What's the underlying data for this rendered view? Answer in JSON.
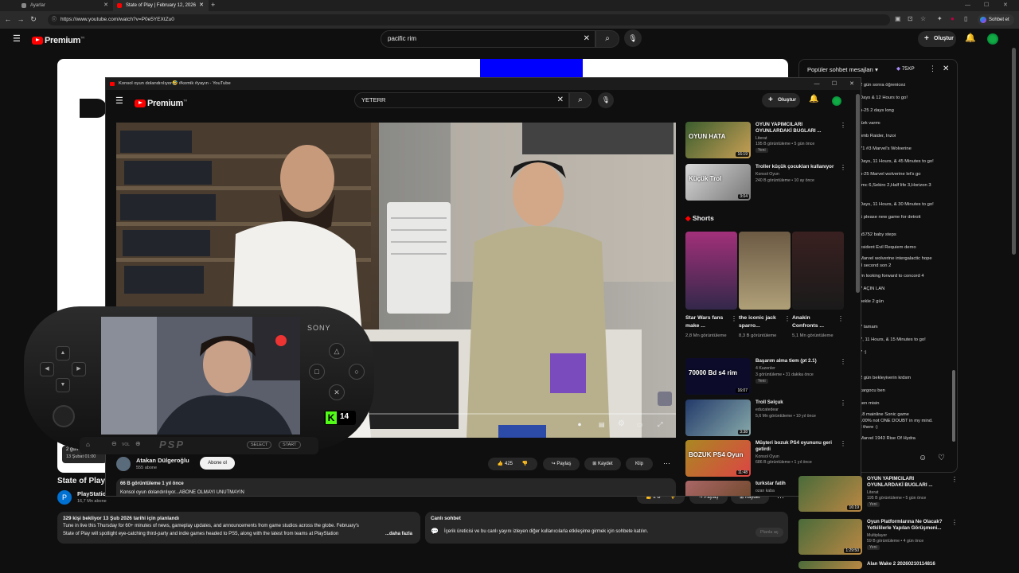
{
  "browser": {
    "tabs": [
      {
        "label": "Ayarlar",
        "active": false
      },
      {
        "label": "State of Play | February 12, 2026",
        "active": true
      }
    ],
    "url": "https://www.youtube.com/watch?v=P0e5YEXtZu0",
    "profile_button": "Sohbet et"
  },
  "main": {
    "logo": "Premium",
    "logo_sup": "TR",
    "search_value": "pacific rim",
    "create_label": "Oluştur",
    "video_title": "State of Play",
    "channel_name": "PlayStation",
    "channel_subs": "16,7 Mn abone",
    "date_overlay": "13 Şubat 01:00",
    "date_overlay_prefix": "2 gün",
    "like_count": "2 B",
    "share_label": "Paylaş",
    "save_label": "Kaydet",
    "desc_header": "329 kişi bekliyor  13 Şub 2026 tarihi için planlandı",
    "desc_line1": "Tune in live this Thursday for 60+ minutes of news, gameplay updates, and announcements from game studios across the globe. February's",
    "desc_line2": "State of Play will spotlight eye-catching third-party and indie games headed to PS5, along with the latest from teams at PlayStation",
    "desc_more": "...daha fazla",
    "live_chat_title": "Canlı sohbet",
    "live_chat_text": "İçerik üreticisi ve bu canlı yayını izleyen diğer kullanıcılarla etkileşime girmek için sohbete katılın.",
    "live_chat_btn": "Planla aç",
    "chat_header": "Popüler sohbet mesajları",
    "chat_points": "75XP",
    "chat_messages": [
      "2 gün sonra öğrenicez",
      "Days & 12 Hours to go!",
      "n-25  2 days long",
      "türk varmı",
      "omb Raider, Inzoi",
      "71  #3  Marvel's Wolverine",
      "Days, 11 Hours, & 45 Minutes to go!",
      "n-25  Marvel wolverine let's go",
      "rmc 6,Sekiro 2,Half life 3,Horizon 3",
      "Days, 11 Hours, & 30 Minutes to go!",
      "5  please new game for detroit",
      "a5752  baby steps",
      "esident Evil Requiem demo",
      "Marvel wolverine intergalactic hope",
      "8 second son 2",
      "im looking forward to concord 4",
      "7  AÇIN LAN",
      "bekle 2 gün",
      "7  tamam",
      "7, 11 Hours, & 15 Minutes to go!",
      "7  :)",
      "2 gün bekleyiverin krdsm",
      "kargocu ben",
      "sen misin",
      "18  mainline Sonic game",
      "100% not ONE DOUBT in my mind.",
      "ll there :)",
      "Marvel 1943 Rise Of Hydra"
    ],
    "right_list": [
      {
        "title": "OYUN YAPIMCILARI OYUNLARDAKİ BUGLARI ...",
        "channel": "Literat",
        "meta": "195 B görüntüleme • 5 gün önce",
        "tag": "Yeni",
        "dur": "16:19"
      },
      {
        "title": "Oyun Platformlarına Ne Olacak? Yetkililerle Yapılan Görüşmeni...",
        "channel": "Multiplayer",
        "meta": "59 B görüntüleme • 4 gün önce",
        "tag": "Yeni",
        "dur": "1:29:50"
      },
      {
        "title": "Alan Wake 2  20260210114816",
        "channel": "",
        "meta": "",
        "tag": "",
        "dur": ""
      }
    ]
  },
  "popup": {
    "window_title": "Konsol oyun dolandırılıyor🤣 #komik #yayın - YouTube",
    "search_value": "YETERR",
    "create_label": "Oluştur",
    "channel_name": "Atakan Dülgeroğlu",
    "channel_subs": "555 abone",
    "subscribe_label": "Abone ol",
    "like_count": "425",
    "share_label": "Paylaş",
    "save_label": "Kaydet",
    "clip_label": "Klip",
    "views": "66 B görüntüleme  1 yıl önce",
    "desc_partial": "Konsol oyun dolandırılıyor...ABONE OLMAYI UNUTMAYIN",
    "kick_count": "14",
    "shorts_label": "Shorts",
    "sidebar_top": [
      {
        "title": "OYUN YAPIMCILARI OYUNLARDAKİ BUGLARI ...",
        "channel": "Literat",
        "meta": "195 B görüntüleme • 5 gün önce",
        "tag": "Yeni",
        "dur": "16:19",
        "thumb_text": "OYUN HATA"
      },
      {
        "title": "Troller küçük çocukları kullanıyor",
        "channel": "Konsol Oyun",
        "meta": "240 B görüntüleme • 10 ay önce",
        "tag": "",
        "dur": "3:04",
        "thumb_text": "Küçük Trol"
      }
    ],
    "shorts": [
      {
        "title": "Star Wars fans make ...",
        "views": "2,8 Mn görüntüleme"
      },
      {
        "title": "the iconic jack sparro...",
        "views": "8,3 B görüntüleme"
      },
      {
        "title": "Anakin Confronts ...",
        "views": "5,1 Mn görüntüleme"
      }
    ],
    "sidebar_bottom": [
      {
        "title": "Başarım alma tiem (pt 2.1)",
        "channel": "4 Kuzenler",
        "meta": "3 görüntüleme • 31 dakika önce",
        "tag": "Yeni",
        "dur": "16:07",
        "thumb_text": "70000 Bd s4 rim"
      },
      {
        "title": "Troll Selçuk",
        "channel": "educatedear",
        "meta": "5,6 Mn görüntüleme • 10 yıl önce",
        "tag": "",
        "dur": "3:38",
        "thumb_text": ""
      },
      {
        "title": "Müşteri bozuk PS4 oyununu geri getirdi",
        "channel": "Konsol Oyun",
        "meta": "686 B görüntüleme • 1 yıl önce",
        "tag": "",
        "dur": "11:48",
        "thumb_text": "BOZUK PS4 Oyun"
      },
      {
        "title": "turkstar fatih",
        "channel": "ozan kaba",
        "meta": "",
        "tag": "",
        "dur": "",
        "thumb_text": ""
      }
    ]
  },
  "psp": {
    "brand": "SONY",
    "logo": "PSP",
    "vol_label": "VOL",
    "select_label": "SELECT",
    "start_label": "START"
  },
  "colors": {
    "accent_red": "#ff0000",
    "bg": "#0f0f0f",
    "blue_block": "#0000ff",
    "kick_green": "#53fc18"
  }
}
